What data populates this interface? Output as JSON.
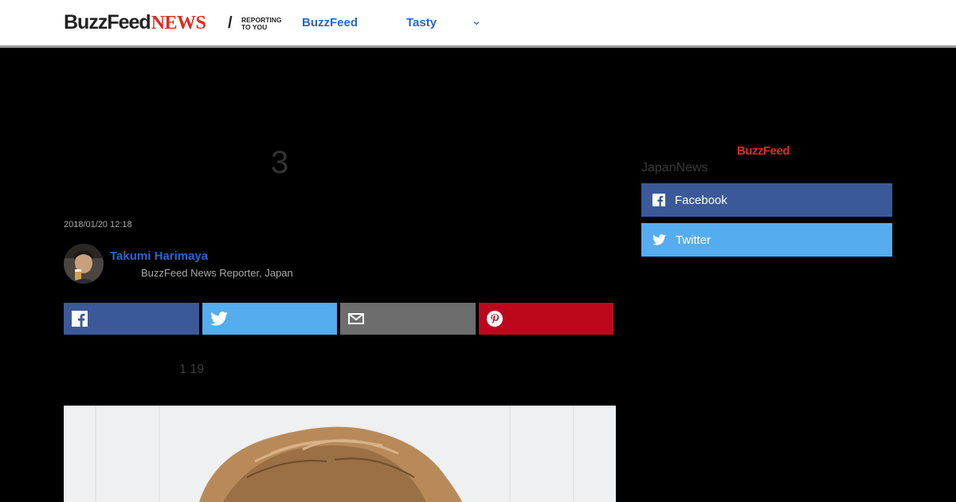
{
  "header": {
    "logo_brand": "BuzzFeed",
    "logo_news": "NEWS",
    "logo_slash": "/",
    "logo_tagline_1": "REPORTING",
    "logo_tagline_2": "TO YOU",
    "nav": [
      {
        "label": "BuzzFeed"
      },
      {
        "label": "Tasty"
      }
    ]
  },
  "article": {
    "headline_fragment": "3",
    "timestamp": "2018/01/20 12:18",
    "author": {
      "name": "Takumi Harimaya",
      "role": "BuzzFeed News Reporter, Japan"
    },
    "body_fragment": "1 19"
  },
  "share": {
    "icons": [
      "facebook-icon",
      "twitter-icon",
      "mail-icon",
      "pinterest-icon"
    ]
  },
  "sidebar": {
    "logo": "BuzzFeed",
    "label": "JapanNews",
    "follow": [
      {
        "label": "Facebook"
      },
      {
        "label": "Twitter"
      }
    ]
  },
  "colors": {
    "link_blue": "#2768c9",
    "brand_red": "#e32a1e",
    "facebook": "#3b5998",
    "twitter": "#55acee",
    "mail": "#6d6d6d",
    "pinterest": "#bd081c"
  }
}
